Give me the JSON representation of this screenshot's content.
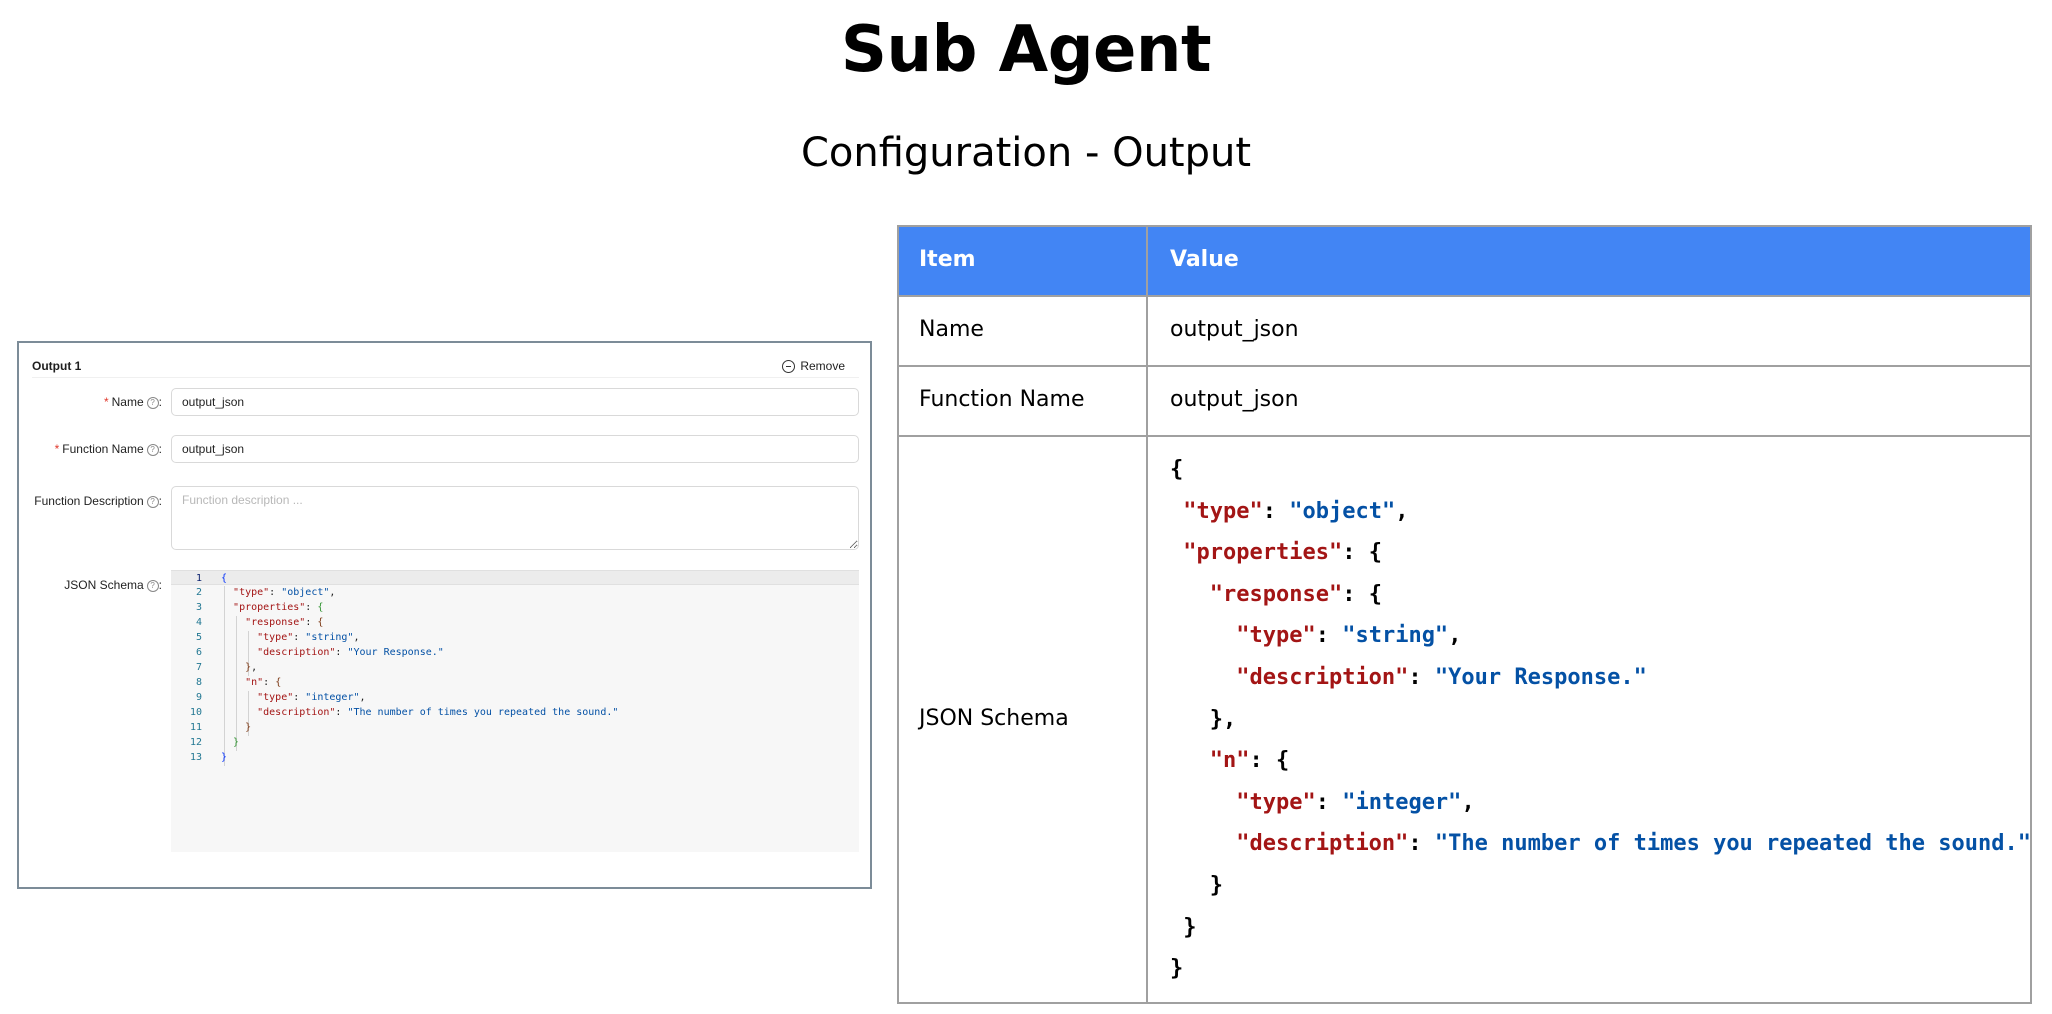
{
  "page": {
    "title": "Sub Agent",
    "subtitle": "Configuration - Output"
  },
  "panel": {
    "title": "Output 1",
    "remove_label": "Remove",
    "help_glyph": "?",
    "fields": {
      "name": {
        "label": "Name",
        "required": true,
        "value": "output_json"
      },
      "function_name": {
        "label": "Function Name",
        "required": true,
        "value": "output_json"
      },
      "function_description": {
        "label": "Function Description",
        "required": false,
        "value": "",
        "placeholder": "Function description ..."
      },
      "json_schema": {
        "label": "JSON Schema",
        "required": false
      }
    },
    "editor": {
      "line_numbers": [
        "1",
        "2",
        "3",
        "4",
        "5",
        "6",
        "7",
        "8",
        "9",
        "10",
        "11",
        "12",
        "13"
      ],
      "active_line": 1
    }
  },
  "table": {
    "headers": [
      "Item",
      "Value"
    ],
    "rows": [
      {
        "item": "Name",
        "value": "output_json"
      },
      {
        "item": "Function Name",
        "value": "output_json"
      },
      {
        "item": "JSON Schema"
      }
    ]
  },
  "schema": {
    "open": "{",
    "type_key": "\"type\"",
    "type_val": "\"object\"",
    "properties_key": "\"properties\"",
    "response_key": "\"response\"",
    "response_type_val": "\"string\"",
    "response_desc_key": "\"description\"",
    "response_desc_val": "\"Your Response.\"",
    "n_key": "\"n\"",
    "n_type_val": "\"integer\"",
    "n_desc_val": "\"The number of times you repeated the sound.\"",
    "close": "}"
  },
  "colors": {
    "header_blue": "#4285f4",
    "json_key": "#a31515",
    "json_string": "#0451a5",
    "required_star": "#e0382c"
  },
  "icons": [
    "minus-circle-icon",
    "question-circle-icon"
  ]
}
